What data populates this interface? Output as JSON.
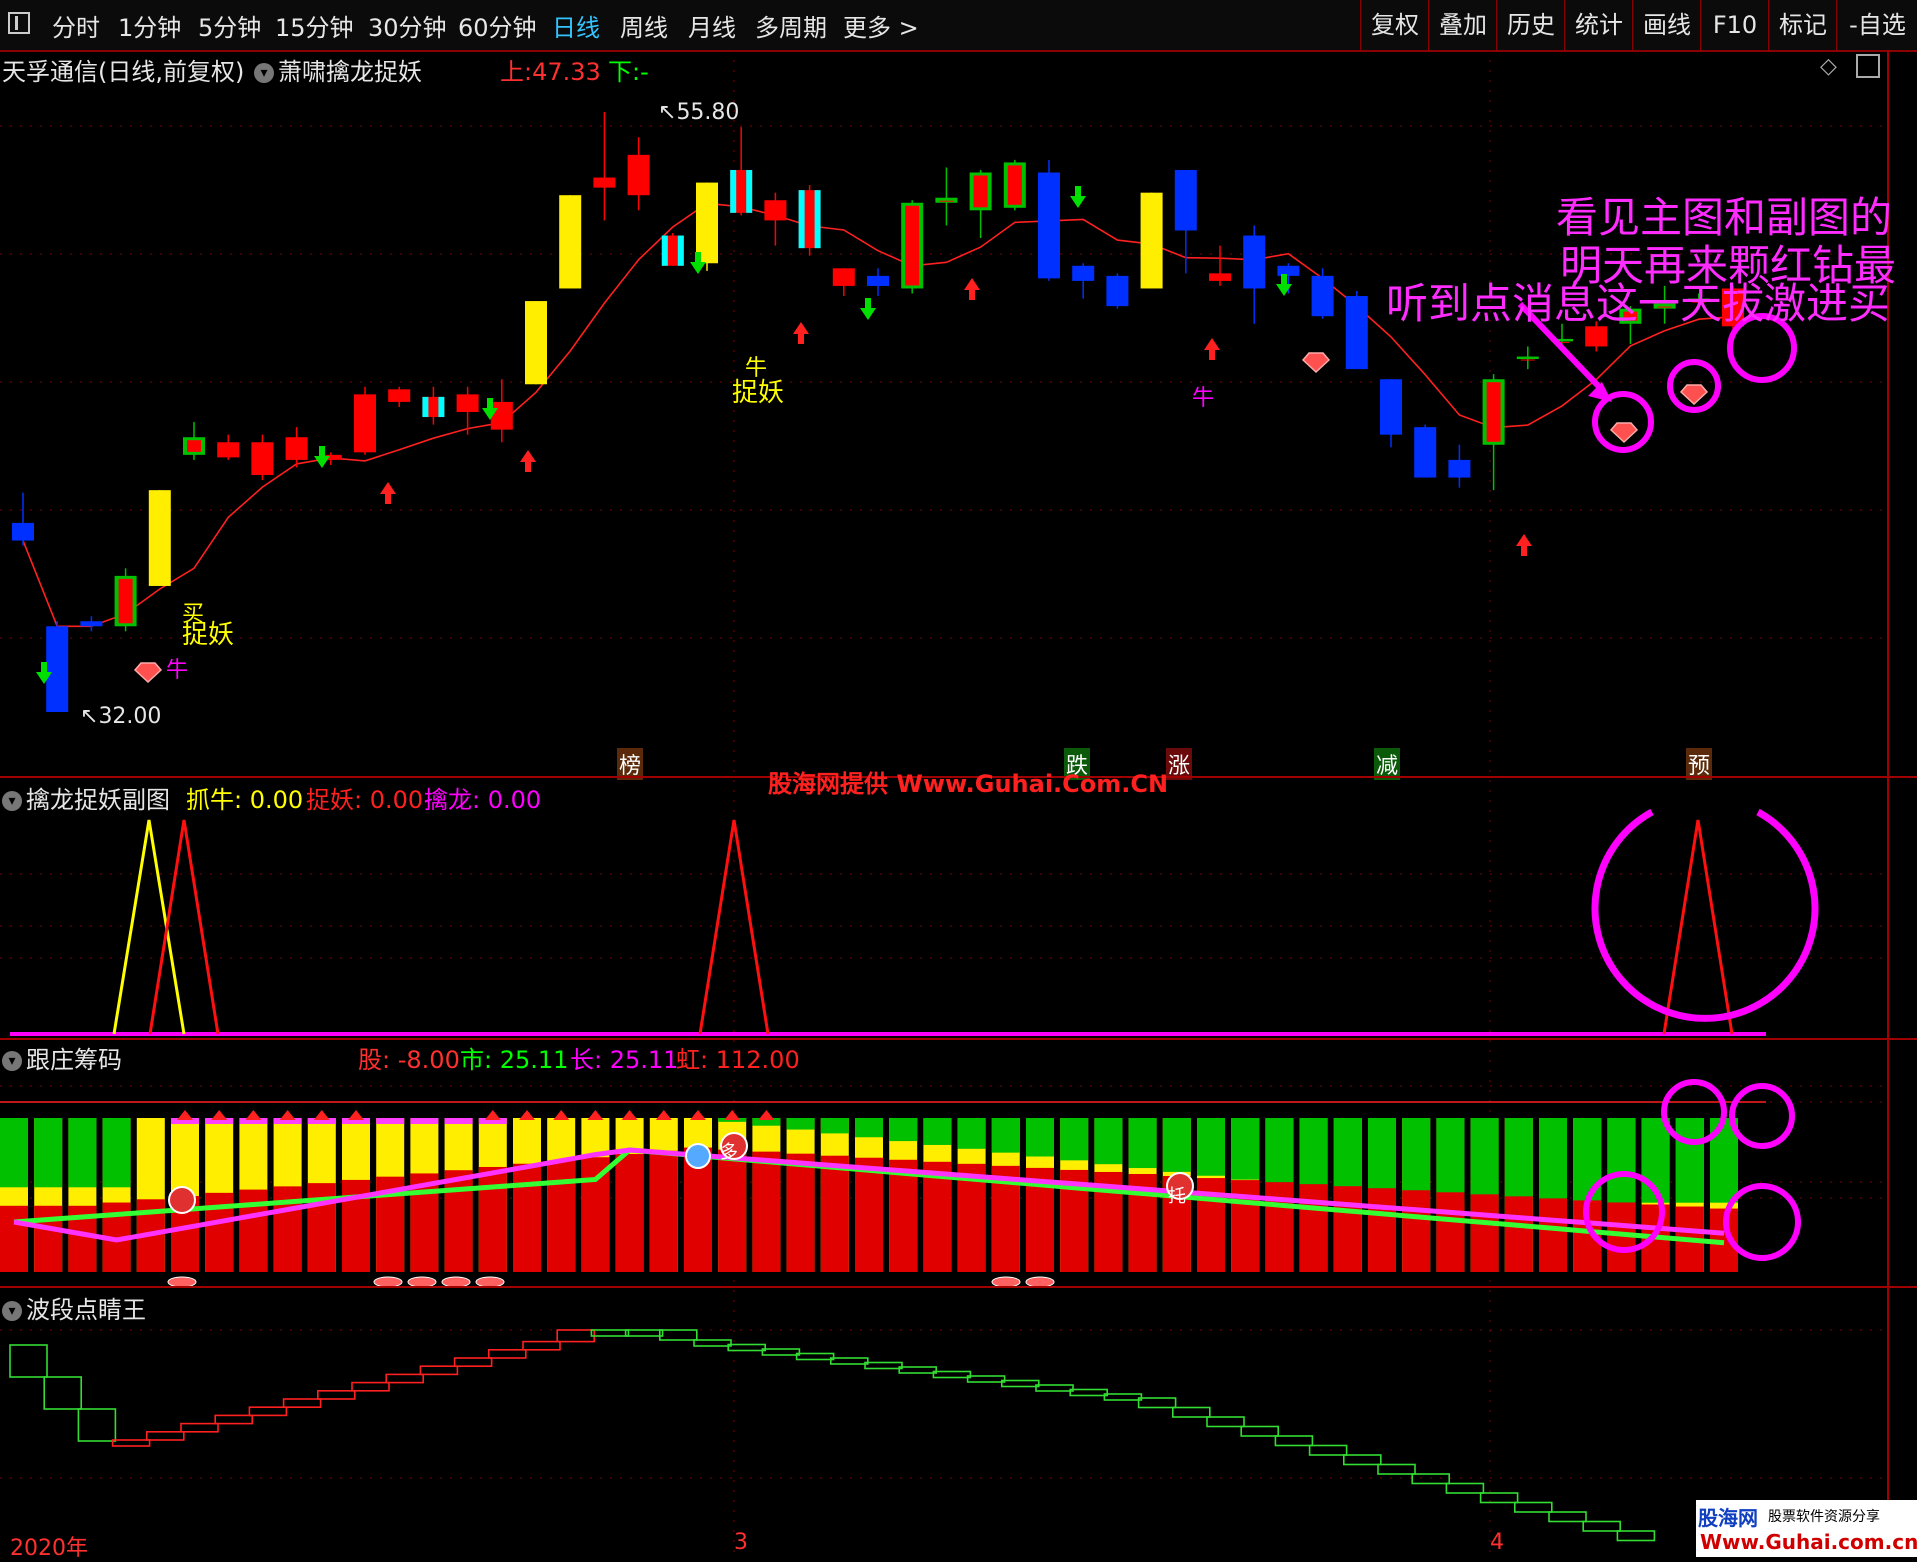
{
  "toolbar": {
    "periods": [
      "分时",
      "1分钟",
      "5分钟",
      "15分钟",
      "30分钟",
      "60分钟",
      "日线",
      "周线",
      "月线",
      "多周期",
      "更多 >"
    ],
    "active_period": "日线",
    "buttons": [
      "复权",
      "叠加",
      "历史",
      "统计",
      "画线",
      "F10",
      "标记",
      "-自选"
    ]
  },
  "main_panel": {
    "title": "天孚通信(日线,前复权)",
    "indicator": "萧啸擒龙捉妖",
    "up_label": "上:",
    "up_value": "47.33",
    "down_label": "下:",
    "down_value": "-",
    "high_label": "55.80",
    "low_label": "32.00",
    "annot_zhuoyao_1": "捉妖",
    "annot_mai": "买",
    "annot_niu_1": "牛",
    "annot_niu_2": "牛",
    "annot_zhuoyao_2": "捉妖",
    "annot_niu_3": "牛",
    "promo_line1": "看见主图和副图的",
    "promo_line2": "明天再来颗红钻最",
    "promo_line3": "听到点消息这一天拔激进买",
    "tags": [
      "榜",
      "跌",
      "涨",
      "减",
      "预"
    ],
    "watermark": "股海网提供 Www.Guhai.Com.CN",
    "colors": {
      "up": "#ff0000",
      "down": "#0000ff",
      "yellow": "#ffff00",
      "cyan": "#00ffff",
      "ma": "#ff2020",
      "magenta": "#ff00ff"
    }
  },
  "sub_panel_1": {
    "title": "擒龙捉妖副图",
    "zhuaniu_label": "抓牛:",
    "zhuaniu_value": "0.00",
    "zhuoyao_label": "捉妖:",
    "zhuoyao_value": "0.00",
    "qinlong_label": "擒龙:",
    "qinlong_value": "0.00"
  },
  "sub_panel_2": {
    "title": "跟庄筹码",
    "gu_label": "股:",
    "gu_value": "-8.00",
    "shi_label": "市:",
    "shi_value": "25.11",
    "chang_label": "长:",
    "chang_value": "25.11",
    "hong_label": "虹:",
    "hong_value": "112.00",
    "tag_duo": "多",
    "tag_tuo": "托"
  },
  "sub_panel_3": {
    "title": "波段点睛王"
  },
  "x_axis": {
    "year_label": "2020年",
    "month_3": "3",
    "month_4": "4"
  },
  "logo": {
    "name": "股海网",
    "slogan": "股票软件资源分享",
    "url": "Www.Guhai.com.cn"
  },
  "chart_data": {
    "type": "candlestick",
    "y_high": 55.8,
    "y_low": 32.0,
    "candles": [
      {
        "o": 39.5,
        "c": 38.8,
        "h": 40.7,
        "l": 38.6,
        "s": "blue"
      },
      {
        "o": 35.4,
        "c": 32.0,
        "h": 35.6,
        "l": 32.0,
        "s": "blue"
      },
      {
        "o": 35.6,
        "c": 35.4,
        "h": 35.8,
        "l": 35.2,
        "s": "blue"
      },
      {
        "o": 35.4,
        "c": 37.4,
        "h": 37.7,
        "l": 35.2,
        "s": "green"
      },
      {
        "o": 37.0,
        "c": 40.8,
        "h": 40.8,
        "l": 37.0,
        "s": "yellow"
      },
      {
        "o": 42.2,
        "c": 42.9,
        "h": 43.5,
        "l": 42.0,
        "s": "green"
      },
      {
        "o": 42.7,
        "c": 42.1,
        "h": 43.0,
        "l": 42.0,
        "s": "red"
      },
      {
        "o": 42.7,
        "c": 41.4,
        "h": 43.0,
        "l": 41.2,
        "s": "red"
      },
      {
        "o": 42.9,
        "c": 42.0,
        "h": 43.3,
        "l": 41.7,
        "s": "red"
      },
      {
        "o": 42.2,
        "c": 42.0,
        "h": 42.3,
        "l": 41.8,
        "s": "red"
      },
      {
        "o": 44.6,
        "c": 42.3,
        "h": 44.9,
        "l": 42.2,
        "s": "red"
      },
      {
        "o": 44.8,
        "c": 44.3,
        "h": 44.9,
        "l": 44.1,
        "s": "red"
      },
      {
        "o": 44.5,
        "c": 43.7,
        "h": 44.9,
        "l": 43.4,
        "s": "cyan"
      },
      {
        "o": 44.6,
        "c": 43.9,
        "h": 44.9,
        "l": 43.0,
        "s": "red"
      },
      {
        "o": 44.3,
        "c": 43.2,
        "h": 45.2,
        "l": 42.7,
        "s": "red"
      },
      {
        "o": 45.0,
        "c": 48.3,
        "h": 48.3,
        "l": 45.0,
        "s": "yellow"
      },
      {
        "o": 48.8,
        "c": 52.5,
        "h": 52.5,
        "l": 48.8,
        "s": "yellow"
      },
      {
        "o": 52.8,
        "c": 53.2,
        "h": 55.8,
        "l": 51.5,
        "s": "red"
      },
      {
        "o": 54.1,
        "c": 52.5,
        "h": 54.8,
        "l": 51.9,
        "s": "red"
      },
      {
        "o": 50.9,
        "c": 49.7,
        "h": 51.0,
        "l": 49.7,
        "s": "cyan"
      },
      {
        "o": 49.8,
        "c": 53.0,
        "h": 53.0,
        "l": 49.5,
        "s": "yellow"
      },
      {
        "o": 53.5,
        "c": 51.8,
        "h": 55.2,
        "l": 51.7,
        "s": "cyan"
      },
      {
        "o": 52.3,
        "c": 51.5,
        "h": 52.6,
        "l": 50.5,
        "s": "red"
      },
      {
        "o": 52.7,
        "c": 50.4,
        "h": 52.9,
        "l": 50.1,
        "s": "cyan"
      },
      {
        "o": 49.6,
        "c": 48.9,
        "h": 49.6,
        "l": 48.5,
        "s": "red"
      },
      {
        "o": 49.3,
        "c": 48.9,
        "h": 49.6,
        "l": 48.5,
        "s": "blue"
      },
      {
        "o": 52.2,
        "c": 48.8,
        "h": 52.3,
        "l": 48.6,
        "s": "green"
      },
      {
        "o": 52.4,
        "c": 52.2,
        "h": 53.6,
        "l": 51.3,
        "s": "green"
      },
      {
        "o": 51.9,
        "c": 53.4,
        "h": 53.5,
        "l": 50.8,
        "s": "green"
      },
      {
        "o": 52.0,
        "c": 53.8,
        "h": 53.9,
        "l": 51.9,
        "s": "green"
      },
      {
        "o": 53.4,
        "c": 49.2,
        "h": 53.9,
        "l": 49.1,
        "s": "blue"
      },
      {
        "o": 49.7,
        "c": 49.1,
        "h": 49.8,
        "l": 48.4,
        "s": "blue"
      },
      {
        "o": 49.3,
        "c": 48.1,
        "h": 49.4,
        "l": 48.0,
        "s": "blue"
      },
      {
        "o": 48.8,
        "c": 52.6,
        "h": 52.6,
        "l": 48.8,
        "s": "yellow"
      },
      {
        "o": 53.5,
        "c": 51.1,
        "h": 53.5,
        "l": 49.4,
        "s": "blue"
      },
      {
        "o": 49.4,
        "c": 49.1,
        "h": 50.5,
        "l": 48.9,
        "s": "red"
      },
      {
        "o": 50.9,
        "c": 48.8,
        "h": 51.3,
        "l": 47.4,
        "s": "blue"
      },
      {
        "o": 49.7,
        "c": 49.3,
        "h": 49.8,
        "l": 48.6,
        "s": "blue"
      },
      {
        "o": 49.3,
        "c": 47.7,
        "h": 49.6,
        "l": 47.6,
        "s": "blue"
      },
      {
        "o": 48.5,
        "c": 45.6,
        "h": 48.7,
        "l": 45.6,
        "s": "blue"
      },
      {
        "o": 45.2,
        "c": 43.0,
        "h": 45.2,
        "l": 42.5,
        "s": "blue"
      },
      {
        "o": 43.3,
        "c": 41.3,
        "h": 43.4,
        "l": 41.3,
        "s": "blue"
      },
      {
        "o": 42.0,
        "c": 41.3,
        "h": 42.6,
        "l": 40.9,
        "s": "blue"
      },
      {
        "o": 42.6,
        "c": 45.2,
        "h": 45.4,
        "l": 40.8,
        "s": "green"
      },
      {
        "o": 46.0,
        "c": 46.1,
        "h": 46.5,
        "l": 45.6,
        "s": "green"
      },
      {
        "o": 46.7,
        "c": 46.8,
        "h": 47.4,
        "l": 46.5,
        "s": "green"
      },
      {
        "o": 47.3,
        "c": 46.5,
        "h": 47.5,
        "l": 46.3,
        "s": "red"
      },
      {
        "o": 47.4,
        "c": 48.0,
        "h": 48.1,
        "l": 46.6,
        "s": "green"
      },
      {
        "o": 48.0,
        "c": 48.2,
        "h": 48.9,
        "l": 47.4,
        "s": "green"
      },
      {
        "o": 48.3,
        "c": 48.4,
        "h": 48.6,
        "l": 48.0,
        "s": "green"
      },
      {
        "o": 48.8,
        "c": 47.3,
        "h": 48.9,
        "l": 47.2,
        "s": "red"
      }
    ]
  }
}
